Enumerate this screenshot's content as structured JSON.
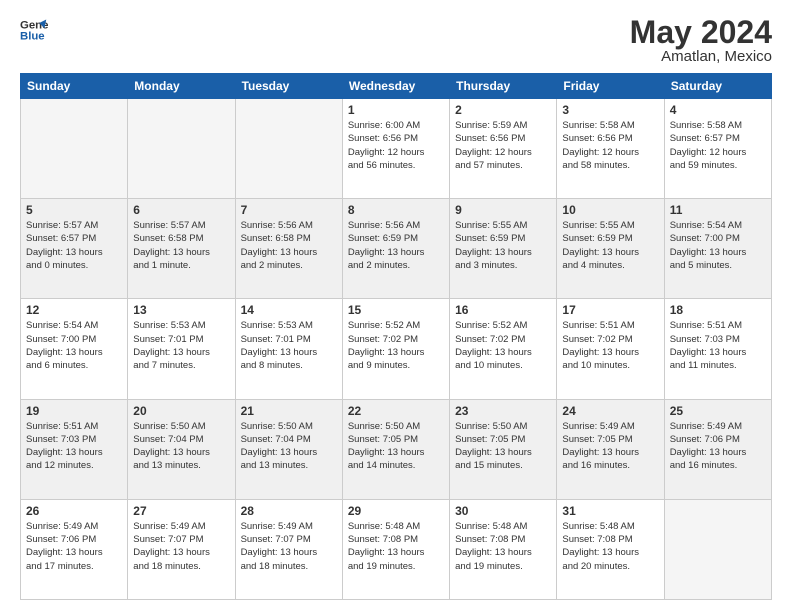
{
  "header": {
    "logo_line1": "General",
    "logo_line2": "Blue",
    "title": "May 2024",
    "subtitle": "Amatlan, Mexico"
  },
  "weekdays": [
    "Sunday",
    "Monday",
    "Tuesday",
    "Wednesday",
    "Thursday",
    "Friday",
    "Saturday"
  ],
  "weeks": [
    [
      {
        "day": "",
        "info": ""
      },
      {
        "day": "",
        "info": ""
      },
      {
        "day": "",
        "info": ""
      },
      {
        "day": "1",
        "info": "Sunrise: 6:00 AM\nSunset: 6:56 PM\nDaylight: 12 hours\nand 56 minutes."
      },
      {
        "day": "2",
        "info": "Sunrise: 5:59 AM\nSunset: 6:56 PM\nDaylight: 12 hours\nand 57 minutes."
      },
      {
        "day": "3",
        "info": "Sunrise: 5:58 AM\nSunset: 6:56 PM\nDaylight: 12 hours\nand 58 minutes."
      },
      {
        "day": "4",
        "info": "Sunrise: 5:58 AM\nSunset: 6:57 PM\nDaylight: 12 hours\nand 59 minutes."
      }
    ],
    [
      {
        "day": "5",
        "info": "Sunrise: 5:57 AM\nSunset: 6:57 PM\nDaylight: 13 hours\nand 0 minutes."
      },
      {
        "day": "6",
        "info": "Sunrise: 5:57 AM\nSunset: 6:58 PM\nDaylight: 13 hours\nand 1 minute."
      },
      {
        "day": "7",
        "info": "Sunrise: 5:56 AM\nSunset: 6:58 PM\nDaylight: 13 hours\nand 2 minutes."
      },
      {
        "day": "8",
        "info": "Sunrise: 5:56 AM\nSunset: 6:59 PM\nDaylight: 13 hours\nand 2 minutes."
      },
      {
        "day": "9",
        "info": "Sunrise: 5:55 AM\nSunset: 6:59 PM\nDaylight: 13 hours\nand 3 minutes."
      },
      {
        "day": "10",
        "info": "Sunrise: 5:55 AM\nSunset: 6:59 PM\nDaylight: 13 hours\nand 4 minutes."
      },
      {
        "day": "11",
        "info": "Sunrise: 5:54 AM\nSunset: 7:00 PM\nDaylight: 13 hours\nand 5 minutes."
      }
    ],
    [
      {
        "day": "12",
        "info": "Sunrise: 5:54 AM\nSunset: 7:00 PM\nDaylight: 13 hours\nand 6 minutes."
      },
      {
        "day": "13",
        "info": "Sunrise: 5:53 AM\nSunset: 7:01 PM\nDaylight: 13 hours\nand 7 minutes."
      },
      {
        "day": "14",
        "info": "Sunrise: 5:53 AM\nSunset: 7:01 PM\nDaylight: 13 hours\nand 8 minutes."
      },
      {
        "day": "15",
        "info": "Sunrise: 5:52 AM\nSunset: 7:02 PM\nDaylight: 13 hours\nand 9 minutes."
      },
      {
        "day": "16",
        "info": "Sunrise: 5:52 AM\nSunset: 7:02 PM\nDaylight: 13 hours\nand 10 minutes."
      },
      {
        "day": "17",
        "info": "Sunrise: 5:51 AM\nSunset: 7:02 PM\nDaylight: 13 hours\nand 10 minutes."
      },
      {
        "day": "18",
        "info": "Sunrise: 5:51 AM\nSunset: 7:03 PM\nDaylight: 13 hours\nand 11 minutes."
      }
    ],
    [
      {
        "day": "19",
        "info": "Sunrise: 5:51 AM\nSunset: 7:03 PM\nDaylight: 13 hours\nand 12 minutes."
      },
      {
        "day": "20",
        "info": "Sunrise: 5:50 AM\nSunset: 7:04 PM\nDaylight: 13 hours\nand 13 minutes."
      },
      {
        "day": "21",
        "info": "Sunrise: 5:50 AM\nSunset: 7:04 PM\nDaylight: 13 hours\nand 13 minutes."
      },
      {
        "day": "22",
        "info": "Sunrise: 5:50 AM\nSunset: 7:05 PM\nDaylight: 13 hours\nand 14 minutes."
      },
      {
        "day": "23",
        "info": "Sunrise: 5:50 AM\nSunset: 7:05 PM\nDaylight: 13 hours\nand 15 minutes."
      },
      {
        "day": "24",
        "info": "Sunrise: 5:49 AM\nSunset: 7:05 PM\nDaylight: 13 hours\nand 16 minutes."
      },
      {
        "day": "25",
        "info": "Sunrise: 5:49 AM\nSunset: 7:06 PM\nDaylight: 13 hours\nand 16 minutes."
      }
    ],
    [
      {
        "day": "26",
        "info": "Sunrise: 5:49 AM\nSunset: 7:06 PM\nDaylight: 13 hours\nand 17 minutes."
      },
      {
        "day": "27",
        "info": "Sunrise: 5:49 AM\nSunset: 7:07 PM\nDaylight: 13 hours\nand 18 minutes."
      },
      {
        "day": "28",
        "info": "Sunrise: 5:49 AM\nSunset: 7:07 PM\nDaylight: 13 hours\nand 18 minutes."
      },
      {
        "day": "29",
        "info": "Sunrise: 5:48 AM\nSunset: 7:08 PM\nDaylight: 13 hours\nand 19 minutes."
      },
      {
        "day": "30",
        "info": "Sunrise: 5:48 AM\nSunset: 7:08 PM\nDaylight: 13 hours\nand 19 minutes."
      },
      {
        "day": "31",
        "info": "Sunrise: 5:48 AM\nSunset: 7:08 PM\nDaylight: 13 hours\nand 20 minutes."
      },
      {
        "day": "",
        "info": ""
      }
    ]
  ]
}
